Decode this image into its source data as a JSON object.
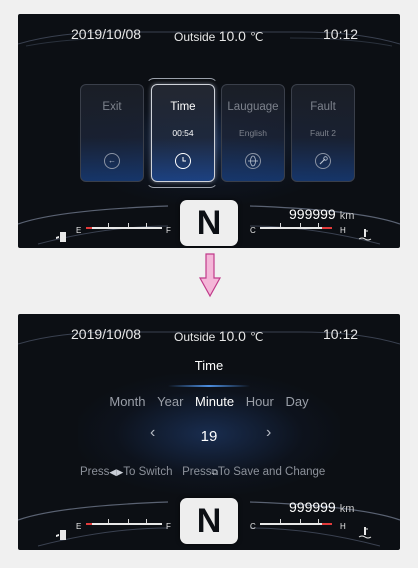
{
  "screen1": {
    "date": "2019/10/08",
    "outside_label": "Outside",
    "outside_temp": "10.0",
    "temp_unit": "℃",
    "clock": "10:12",
    "menu": [
      {
        "label": "Exit",
        "value": "",
        "icon": "back-arrow-icon"
      },
      {
        "label": "Time",
        "value": "00:54",
        "icon": "clock-icon",
        "active": true
      },
      {
        "label": "Lauguage",
        "value": "English",
        "icon": "globe-icon"
      },
      {
        "label": "Fault",
        "value": "Fault 2",
        "icon": "wrench-icon"
      }
    ],
    "gear": "N",
    "odometer": "999999",
    "odometer_unit": "km",
    "fuel_empty": "E",
    "fuel_full": "F",
    "temp_cold": "C",
    "temp_hot": "H"
  },
  "screen2": {
    "date": "2019/10/08",
    "outside_label": "Outside",
    "outside_temp": "10.0",
    "temp_unit": "℃",
    "clock": "10:12",
    "title": "Time",
    "tabs": [
      "Month",
      "Year",
      "Minute",
      "Hour",
      "Day"
    ],
    "active_tab": "Minute",
    "value": "19",
    "prev": "‹",
    "next": "›",
    "help_press1": "Press",
    "help_switch": "To Switch",
    "help_press2": "Press",
    "help_save": "To Save and Change",
    "gear": "N",
    "odometer": "999999",
    "odometer_unit": "km",
    "fuel_empty": "E",
    "fuel_full": "F",
    "temp_cold": "C",
    "temp_hot": "H"
  },
  "colors": {
    "accent_red": "#e23b3b",
    "arrow_pink": "#f4b6d8",
    "glow_blue": "#2f5fae"
  }
}
